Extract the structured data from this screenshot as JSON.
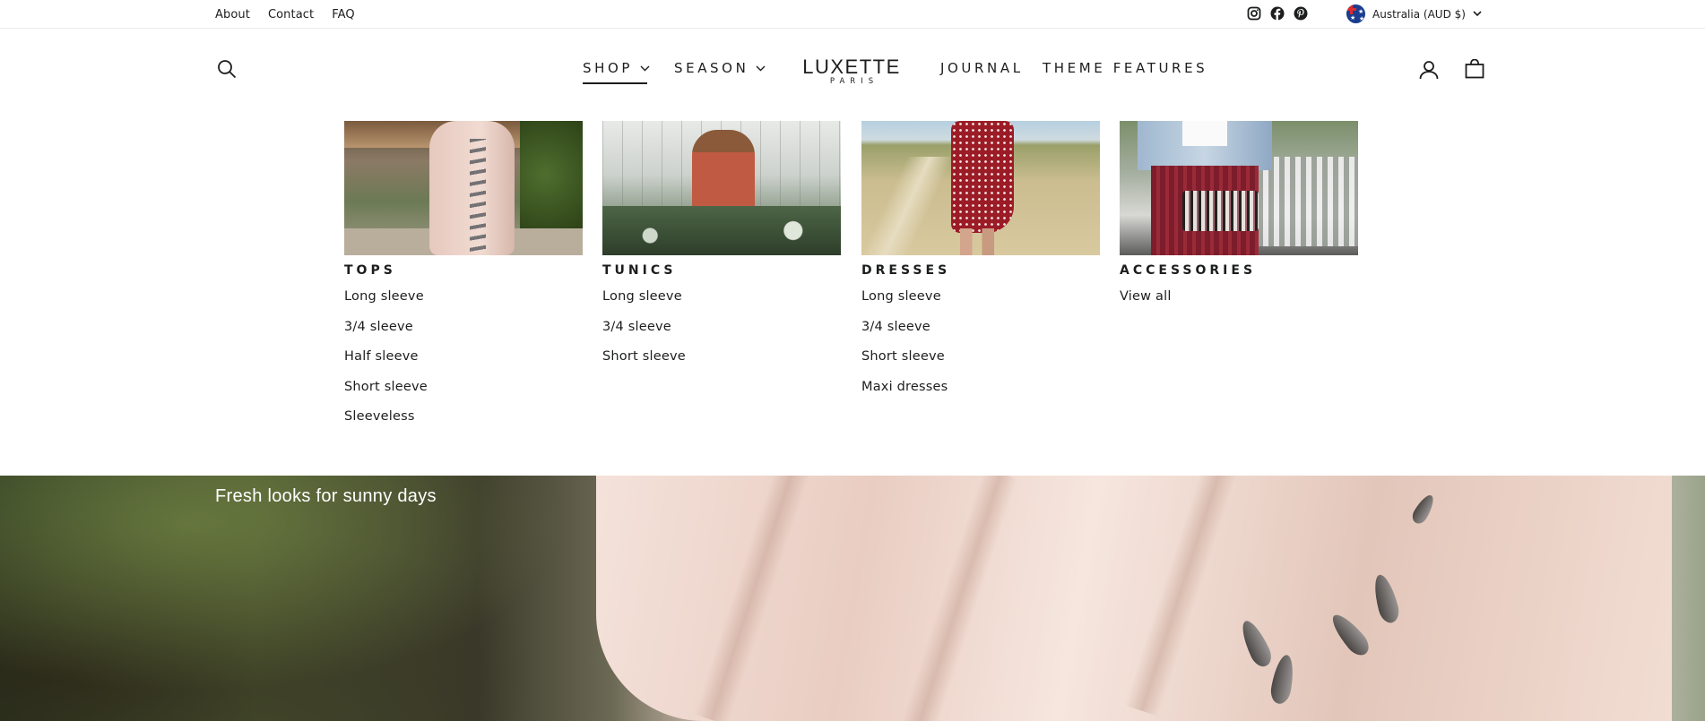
{
  "utility": {
    "links": [
      "About",
      "Contact",
      "FAQ"
    ],
    "currency": "Australia (AUD $)",
    "social_icons": [
      "instagram-icon",
      "facebook-icon",
      "pinterest-icon"
    ]
  },
  "header": {
    "logo_main": "LUXETTE",
    "logo_sub": "PARIS",
    "nav": {
      "shop": "SHOP",
      "season": "SEASON",
      "journal": "JOURNAL",
      "theme": "THEME FEATURES"
    },
    "icons": [
      "search-icon",
      "account-icon",
      "cart-icon"
    ]
  },
  "mega_menu": {
    "columns": [
      {
        "title": "TOPS",
        "links": [
          "Long sleeve",
          "3/4 sleeve",
          "Half sleeve",
          "Short sleeve",
          "Sleeveless"
        ]
      },
      {
        "title": "TUNICS",
        "links": [
          "Long sleeve",
          "3/4 sleeve",
          "Short sleeve"
        ]
      },
      {
        "title": "DRESSES",
        "links": [
          "Long sleeve",
          "3/4 sleeve",
          "Short sleeve",
          "Maxi dresses"
        ]
      },
      {
        "title": "ACCESSORIES",
        "links": [
          "View all"
        ]
      }
    ]
  },
  "hero": {
    "subtitle": "Fresh looks for sunny days"
  },
  "colors": {
    "text": "#1c1d1d",
    "background": "#ffffff",
    "border": "#ececec"
  }
}
